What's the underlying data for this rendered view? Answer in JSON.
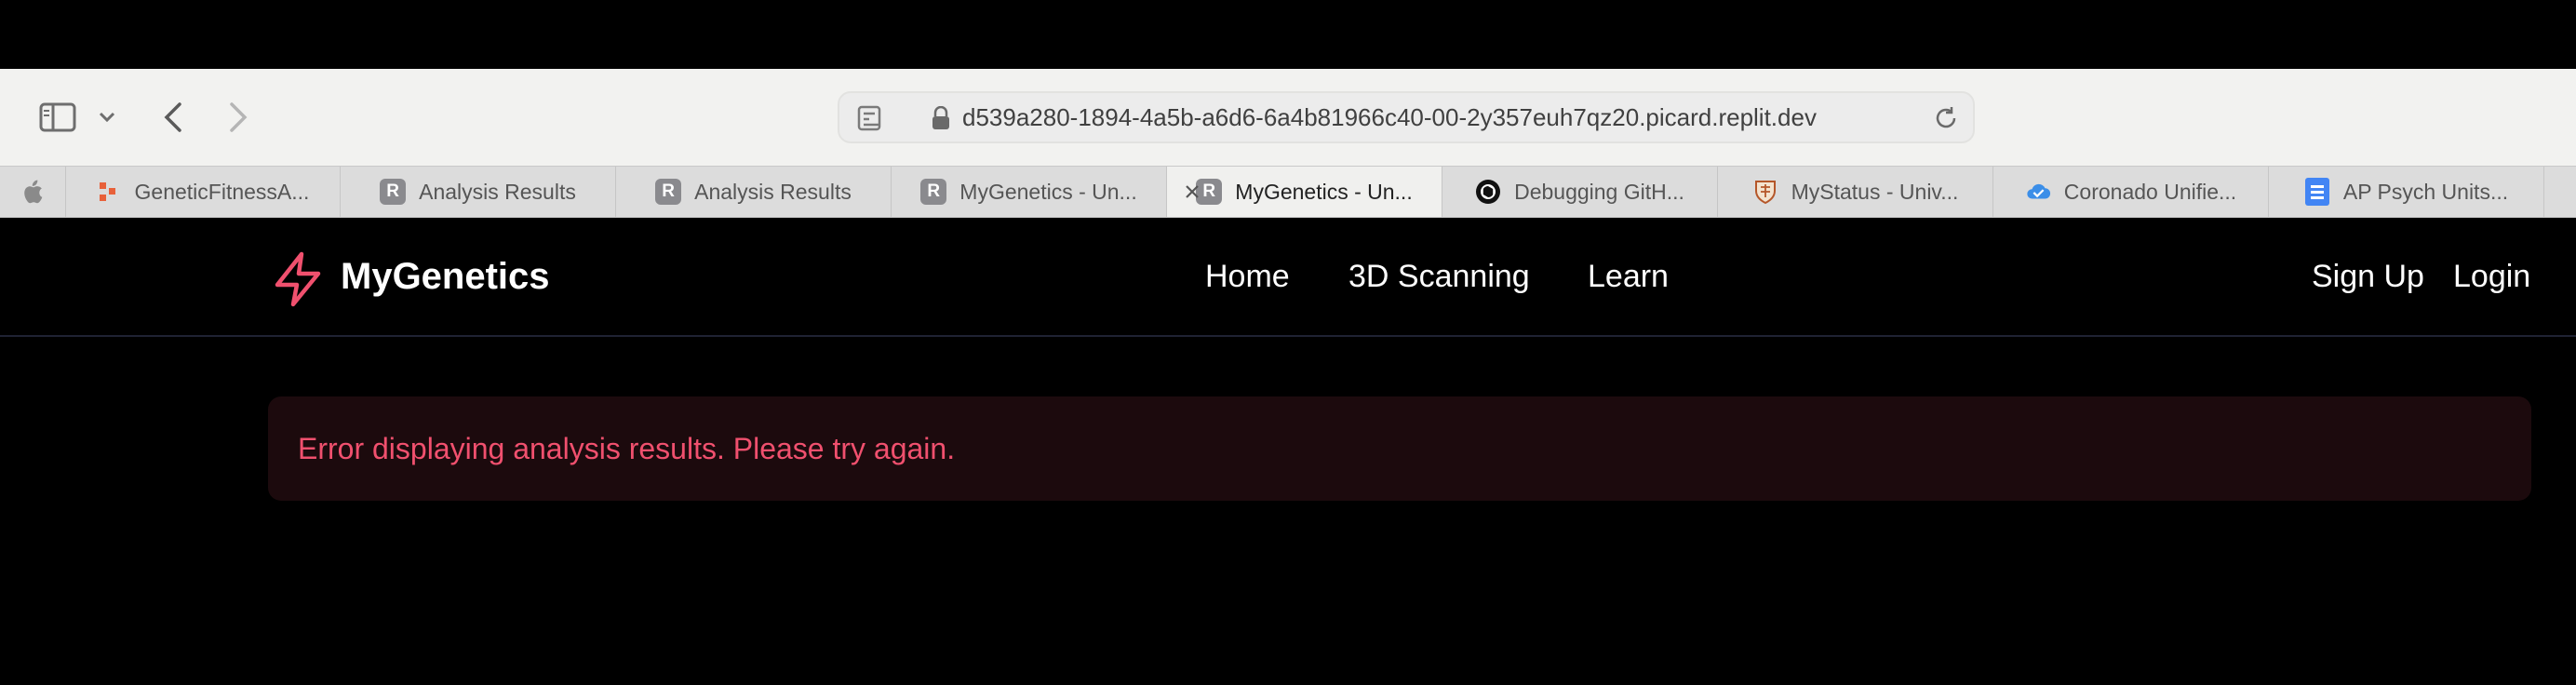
{
  "browser": {
    "url": "d539a280-1894-4a5b-a6d6-6a4b81966c40-00-2y357euh7qz20.picard.replit.dev",
    "tabs": [
      {
        "label": "GeneticFitnessA...",
        "favicon": "generic-fitness-icon"
      },
      {
        "label": "Analysis Results",
        "favicon": "replit-r-icon"
      },
      {
        "label": "Analysis Results",
        "favicon": "replit-r-icon"
      },
      {
        "label": "MyGenetics - Un...",
        "favicon": "replit-r-icon"
      },
      {
        "label": "MyGenetics - Un...",
        "favicon": "replit-r-icon",
        "active": true
      },
      {
        "label": "Debugging GitH...",
        "favicon": "openai-icon"
      },
      {
        "label": "MyStatus - Univ...",
        "favicon": "shield-crest-icon"
      },
      {
        "label": "Coronado Unifie...",
        "favicon": "cloud-check-icon"
      },
      {
        "label": "AP Psych Units...",
        "favicon": "google-docs-icon"
      }
    ]
  },
  "app": {
    "brand": "MyGenetics",
    "brand_color": "#f0506e",
    "nav": {
      "home": "Home",
      "scanning": "3D Scanning",
      "learn": "Learn",
      "signup": "Sign Up",
      "login": "Login"
    },
    "error_message": "Error displaying analysis results. Please try again."
  }
}
